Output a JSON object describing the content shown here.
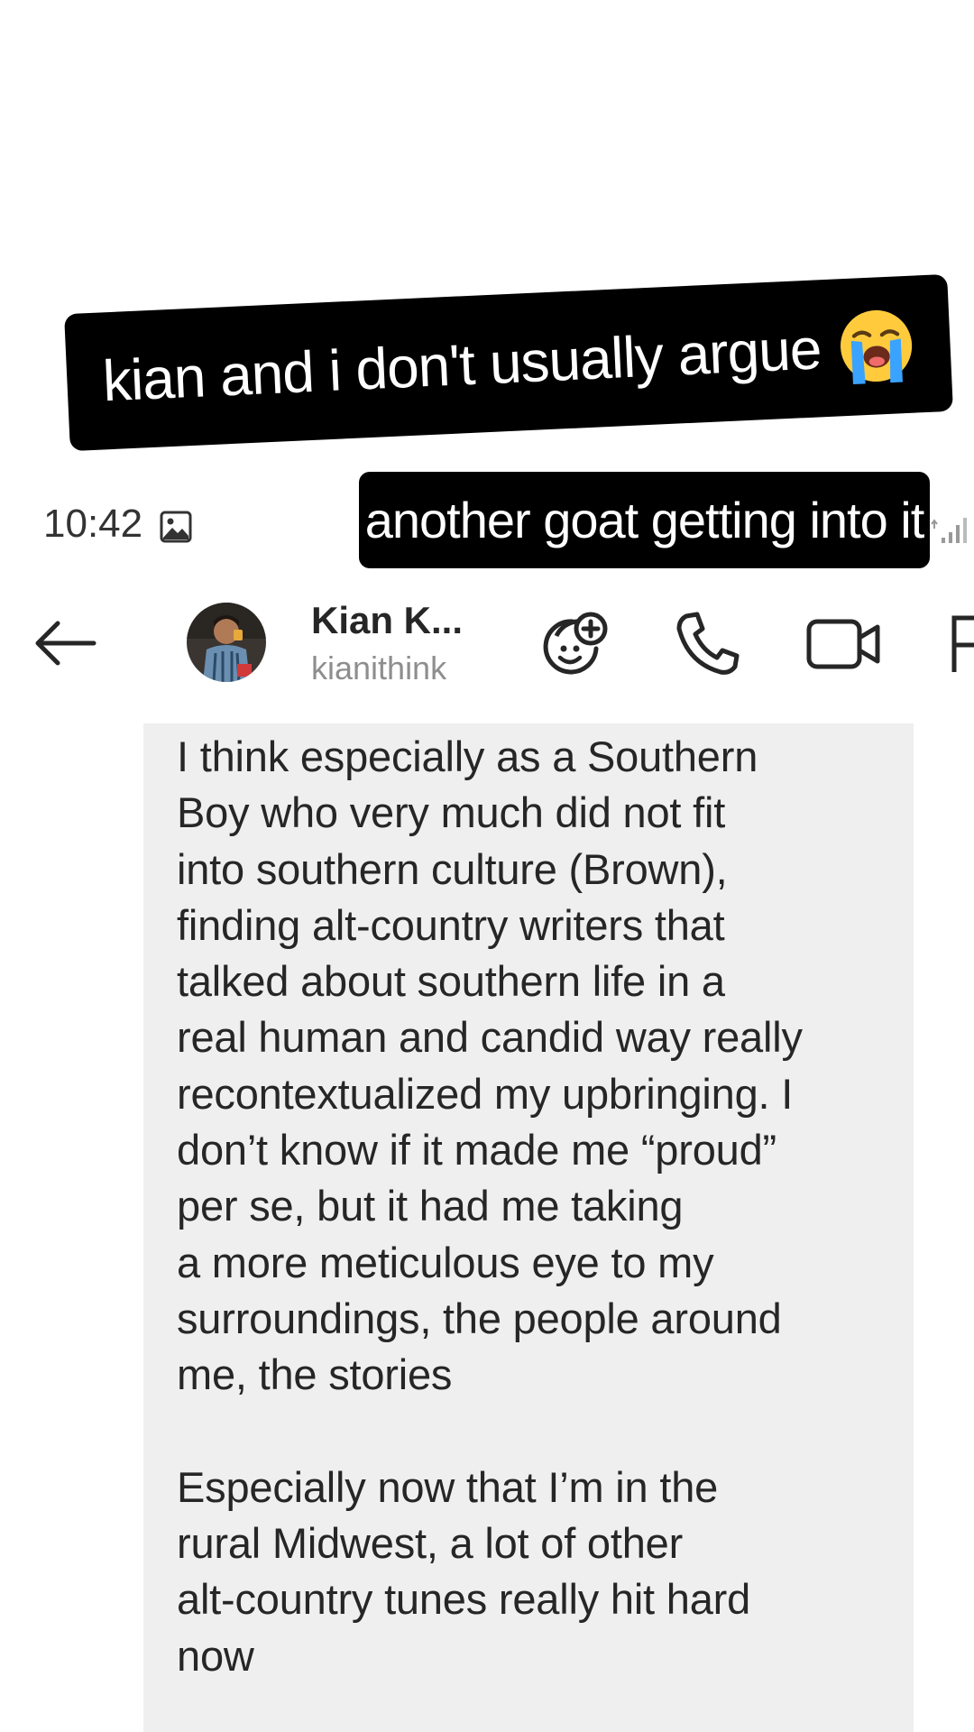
{
  "captions": {
    "top": "kian and i don't usually argue",
    "top_emoji": "loudly-crying-face-emoji",
    "second": "another goat getting into it"
  },
  "status_bar": {
    "time": "10:42",
    "icons": [
      "gallery-icon",
      "signal-icon"
    ]
  },
  "header": {
    "contact_name": "Kian K...",
    "contact_handle": "kianithink",
    "icons": [
      "back-arrow-icon",
      "avatar",
      "effects-add-icon",
      "phone-icon",
      "video-camera-icon",
      "flag-icon"
    ]
  },
  "message": {
    "text": "I think especially as a Southern\nBoy who very much did not fit\ninto southern culture (Brown),\nfinding alt-country writers that\ntalked about southern life in a\nreal human and candid way really\nrecontextualized my upbringing. I\ndon’t know if it made me “proud”\nper se, but it had me taking\na more meticulous eye to my\nsurroundings, the people around\nme, the stories\n\nEspecially now that I’m in the\nrural Midwest, a lot of other\nalt-country tunes really hit hard\nnow"
  },
  "colors": {
    "caption_bg": "#000000",
    "caption_text": "#ffffff",
    "bubble_bg": "#efefef",
    "handle_text": "#8e8e8e"
  }
}
